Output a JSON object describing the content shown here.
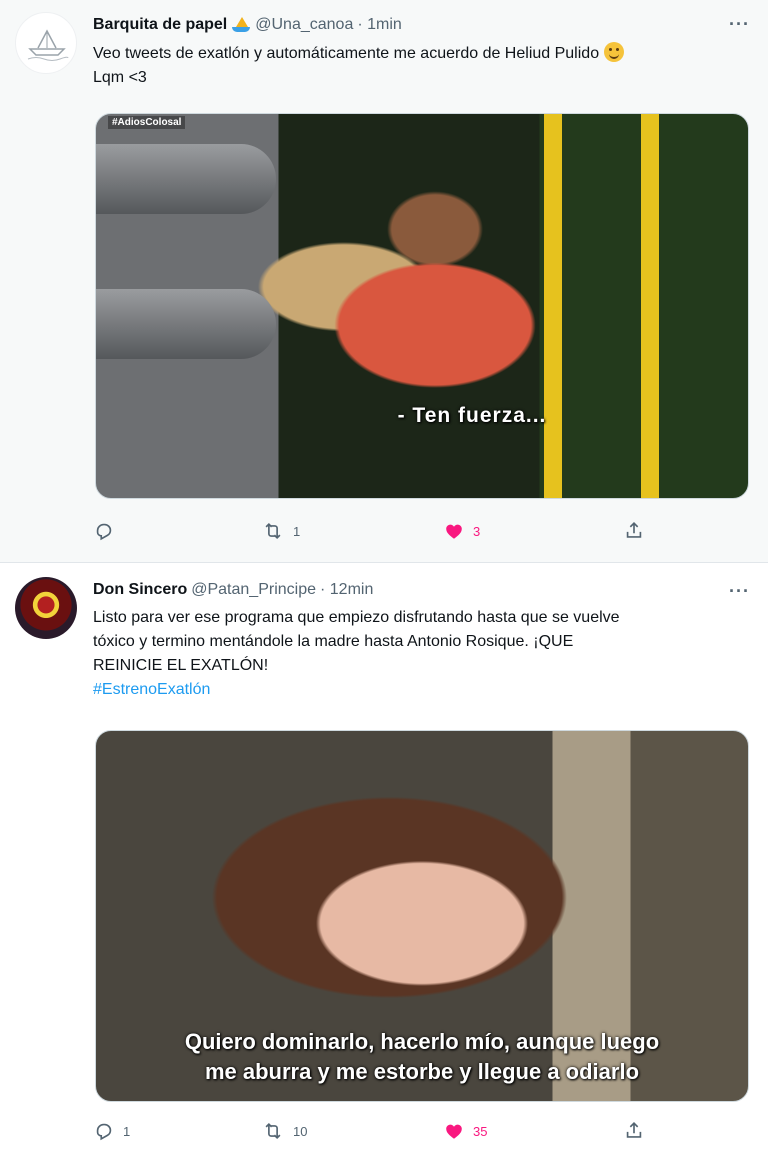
{
  "tweets": [
    {
      "name": "Barquita de papel",
      "handle": "@Una_canoa",
      "time": "· 1min",
      "text_line1": "Veo tweets de exatlón y automáticamente me acuerdo de Heliud Pulido",
      "text_line2": "Lqm <3",
      "media_tag": "#AdiosColosal",
      "media_caption": "- Ten fuerza...",
      "replies": "",
      "retweets": "1",
      "likes": "3",
      "liked": true,
      "more": "···"
    },
    {
      "name": "Don Sincero",
      "handle": "@Patan_Principe",
      "time": "· 12min",
      "text_line1": "Listo para ver ese programa que empiezo disfrutando hasta que se vuelve",
      "text_line2": "tóxico y termino mentándole la madre hasta Antonio Rosique. ¡QUE",
      "text_line3": "REINICIE EL EXATLÓN!",
      "hashtag": "#EstrenoExatlón",
      "media_caption_line1": "Quiero dominarlo, hacerlo mío, aunque luego",
      "media_caption_line2": "me aburra y me estorbe y llegue a odiarlo",
      "replies": "1",
      "retweets": "10",
      "likes": "35",
      "liked": true,
      "more": "···"
    }
  ],
  "colors": {
    "like_active": "#f91880",
    "link": "#1d9bf0",
    "secondary_text": "#536471"
  },
  "icons": [
    "reply-icon",
    "retweet-icon",
    "like-icon",
    "share-icon",
    "more-icon",
    "sailboat-emoji",
    "smiling-emoji"
  ]
}
